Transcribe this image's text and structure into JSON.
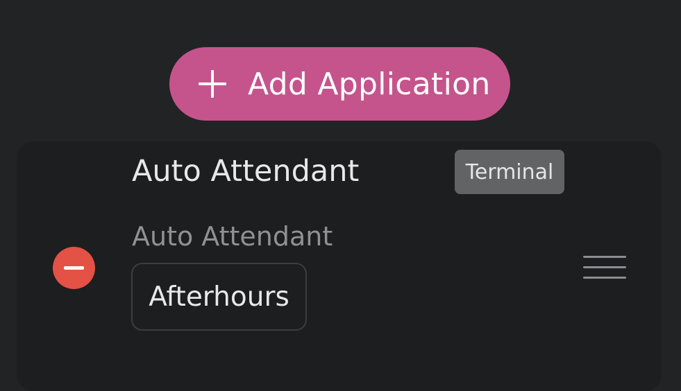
{
  "toolbar": {
    "add_label": "Add Application",
    "add_icon": "plus-icon",
    "accent": "#c5548c"
  },
  "application": {
    "title": "Auto Attendant",
    "tag": "Terminal",
    "subtitle": "Auto Attendant",
    "value": "Afterhours",
    "remove_icon": "minus-circle-icon",
    "remove_color": "#e35245",
    "drag_icon": "drag-handle-icon"
  }
}
